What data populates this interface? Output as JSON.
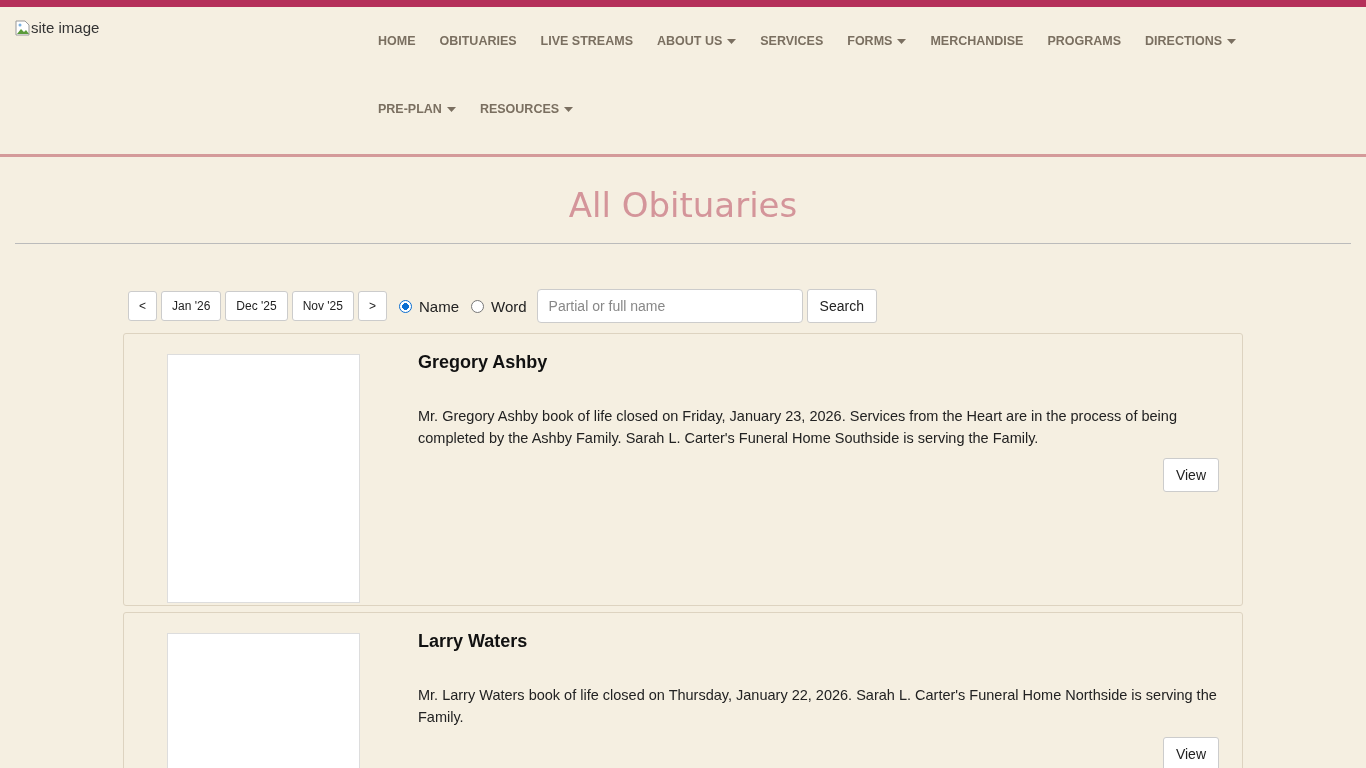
{
  "header": {
    "logo": {
      "alt_text": "site image"
    },
    "nav": [
      {
        "label": "HOME",
        "dropdown": false
      },
      {
        "label": "OBITUARIES",
        "dropdown": false
      },
      {
        "label": "LIVE STREAMS",
        "dropdown": false
      },
      {
        "label": "ABOUT US",
        "dropdown": true
      },
      {
        "label": "SERVICES",
        "dropdown": false
      },
      {
        "label": "FORMS",
        "dropdown": true
      },
      {
        "label": "MERCHANDISE",
        "dropdown": false
      },
      {
        "label": "PROGRAMS",
        "dropdown": false
      },
      {
        "label": "DIRECTIONS",
        "dropdown": true
      },
      {
        "label": "PRE-PLAN",
        "dropdown": true
      },
      {
        "label": "RESOURCES",
        "dropdown": true
      }
    ]
  },
  "page_title": "All Obituaries",
  "toolbar": {
    "prev": "<",
    "months": [
      "Jan '26",
      "Dec '25",
      "Nov '25"
    ],
    "next": ">",
    "search_modes": [
      {
        "label": "Name",
        "selected": true
      },
      {
        "label": "Word",
        "selected": false
      }
    ],
    "search": {
      "placeholder": "Partial or full name"
    },
    "search_button": "Search"
  },
  "obituaries": [
    {
      "name": "Gregory Ashby",
      "summary": "Mr. Gregory Ashby book of life closed on Friday, January 23, 2026. Services from the Heart are in the process of being completed by the Ashby Family. Sarah L. Carter's Funeral Home Southside is serving the Family.",
      "button": "View"
    },
    {
      "name": "Larry Waters",
      "summary": "Mr. Larry Waters book of life closed on Thursday, January 22, 2026. Sarah L. Carter's Funeral Home Northside is serving the Family.",
      "button": "View"
    }
  ]
}
